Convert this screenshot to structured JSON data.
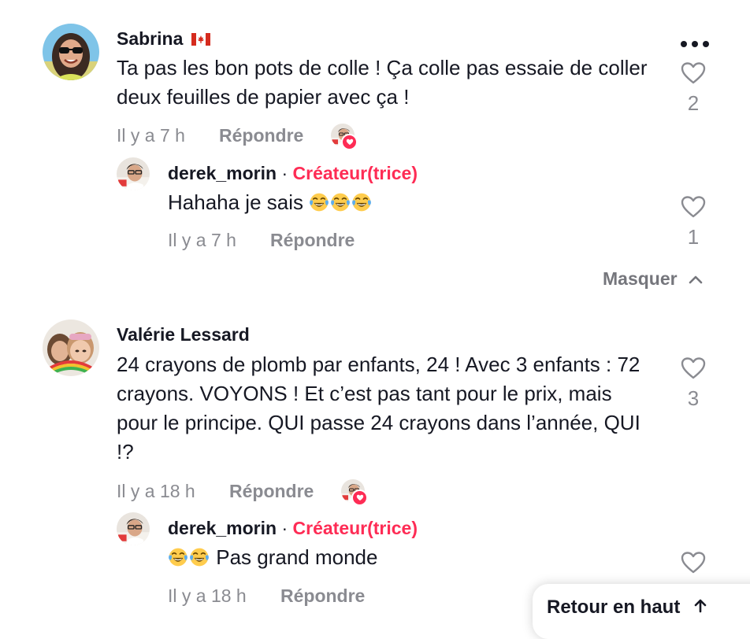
{
  "comments": [
    {
      "username": "Sabrina",
      "flag": "canada-flag",
      "text": "Ta pas les bon pots de colle ! Ça colle pas essaie de coller deux feuilles de papier avec ça !",
      "time": "Il y a 7 h",
      "reply_label": "Répondre",
      "likes": "2",
      "reply": {
        "username": "derek_morin",
        "separator": "·",
        "badge": "Créateur(trice)",
        "text": "Hahaha je sais",
        "emojis": [
          "laughing-tears",
          "laughing-tears",
          "laughing-tears"
        ],
        "time": "Il y a 7 h",
        "reply_label": "Répondre",
        "likes": "1"
      },
      "hide_label": "Masquer"
    },
    {
      "username": "Valérie Lessard",
      "text": "24 crayons de plomb par enfants, 24 ! Avec 3 enfants : 72 crayons. VOYONS ! Et c’est pas tant pour le prix, mais pour le principe. QUI passe 24 crayons dans l’année, QUI !?",
      "time": "Il y a 18 h",
      "reply_label": "Répondre",
      "likes": "3",
      "reply": {
        "username": "derek_morin",
        "separator": "·",
        "badge": "Créateur(trice)",
        "text": "Pas grand monde",
        "emojis": [
          "laughing-tears",
          "laughing-tears"
        ],
        "time": "Il y a 18 h",
        "reply_label": "Répondre",
        "likes": ""
      }
    }
  ],
  "toast": {
    "label": "Retour en haut"
  },
  "colors": {
    "accent": "#fe2c55",
    "muted": "#8a8b91",
    "text": "#161823"
  }
}
